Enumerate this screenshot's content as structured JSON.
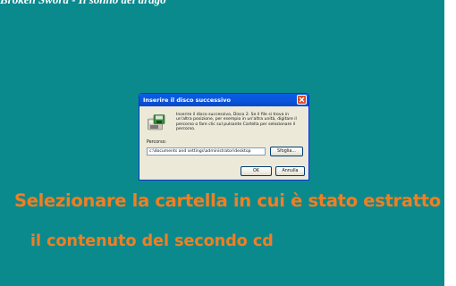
{
  "slide": {
    "top_title": "Broken Sword - Il sonno del drago",
    "caption_line1": "Selezionare la cartella in cui è stato estratto",
    "caption_line2": "il contenuto del secondo cd",
    "background_color": "#0b8a8e",
    "caption_color": "#f07f22"
  },
  "dialog": {
    "title": "Inserire il disco successivo",
    "message": "Inserire il disco successivo, Disco 2. Se il file si trova in un'altra posizione, per esempio in un'altra unità, digitare il percorso o fare clic sul pulsante Cartella per selezionare il percorso.",
    "path_label": "Percorso:",
    "path_value": "c:\\documents and settings\\administrator\\desktop",
    "browse_label": "Sfoglia...",
    "ok_label": "OK",
    "cancel_label": "Annulla",
    "icons": {
      "close": "close-icon",
      "disk": "disk-icon"
    }
  }
}
